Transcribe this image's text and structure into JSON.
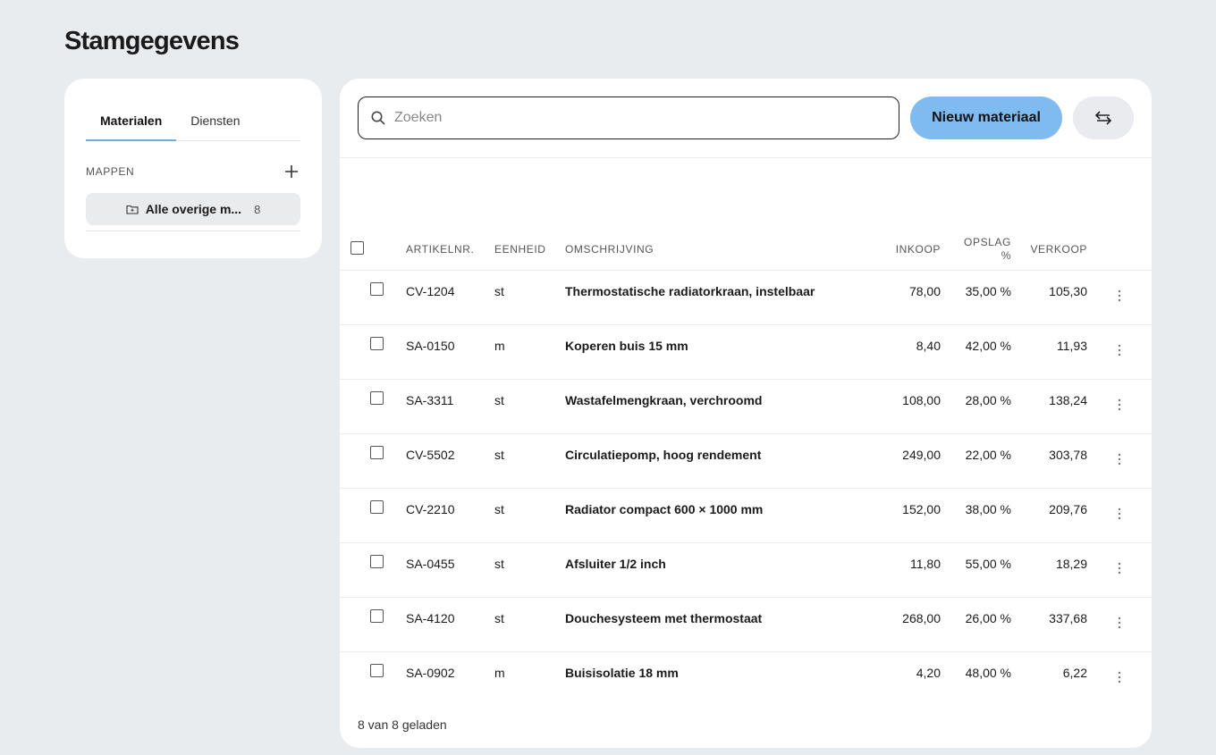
{
  "page": {
    "title": "Stamgegevens"
  },
  "sidebar": {
    "tabs": [
      {
        "label": "Materialen",
        "active": true
      },
      {
        "label": "Diensten",
        "active": false
      }
    ],
    "folders_label": "MAPPEN",
    "add_icon": "plus-icon",
    "folder": {
      "name": "Alle overige m...",
      "count": "8",
      "icon": "folder-icon"
    }
  },
  "toolbar": {
    "search_placeholder": "Zoeken",
    "new_button_label": "Nieuw materiaal",
    "swap_icon": "swap-arrows-icon"
  },
  "table": {
    "headers": {
      "article": "ARTIKELNR.",
      "unit": "EENHEID",
      "description": "OMSCHRIJVING",
      "purchase": "INKOOP",
      "markup_line1": "OPSLAG",
      "markup_line2": "%",
      "sale": "VERKOOP"
    },
    "rows": [
      {
        "article": "CV-1204",
        "unit": "st",
        "description": "Thermostatische radiatorkraan, instelbaar",
        "purchase": "78,00",
        "markup": "35,00 %",
        "sale": "105,30"
      },
      {
        "article": "SA-0150",
        "unit": "m",
        "description": "Koperen buis 15 mm",
        "purchase": "8,40",
        "markup": "42,00 %",
        "sale": "11,93"
      },
      {
        "article": "SA-3311",
        "unit": "st",
        "description": "Wastafelmengkraan, verchroomd",
        "purchase": "108,00",
        "markup": "28,00 %",
        "sale": "138,24"
      },
      {
        "article": "CV-5502",
        "unit": "st",
        "description": "Circulatiepomp, hoog rendement",
        "purchase": "249,00",
        "markup": "22,00 %",
        "sale": "303,78"
      },
      {
        "article": "CV-2210",
        "unit": "st",
        "description": "Radiator compact 600 × 1000 mm",
        "purchase": "152,00",
        "markup": "38,00 %",
        "sale": "209,76"
      },
      {
        "article": "SA-0455",
        "unit": "st",
        "description": "Afsluiter 1/2 inch",
        "purchase": "11,80",
        "markup": "55,00 %",
        "sale": "18,29"
      },
      {
        "article": "SA-4120",
        "unit": "st",
        "description": "Douchesysteem met thermostaat",
        "purchase": "268,00",
        "markup": "26,00 %",
        "sale": "337,68"
      },
      {
        "article": "SA-0902",
        "unit": "m",
        "description": "Buisisolatie 18 mm",
        "purchase": "4,20",
        "markup": "48,00 %",
        "sale": "6,22"
      }
    ]
  },
  "footer": {
    "status": "8 van 8 geladen"
  },
  "colors": {
    "accent": "#7fbaf0",
    "tab_underline": "#6aaee8",
    "background": "#e9ecef"
  }
}
